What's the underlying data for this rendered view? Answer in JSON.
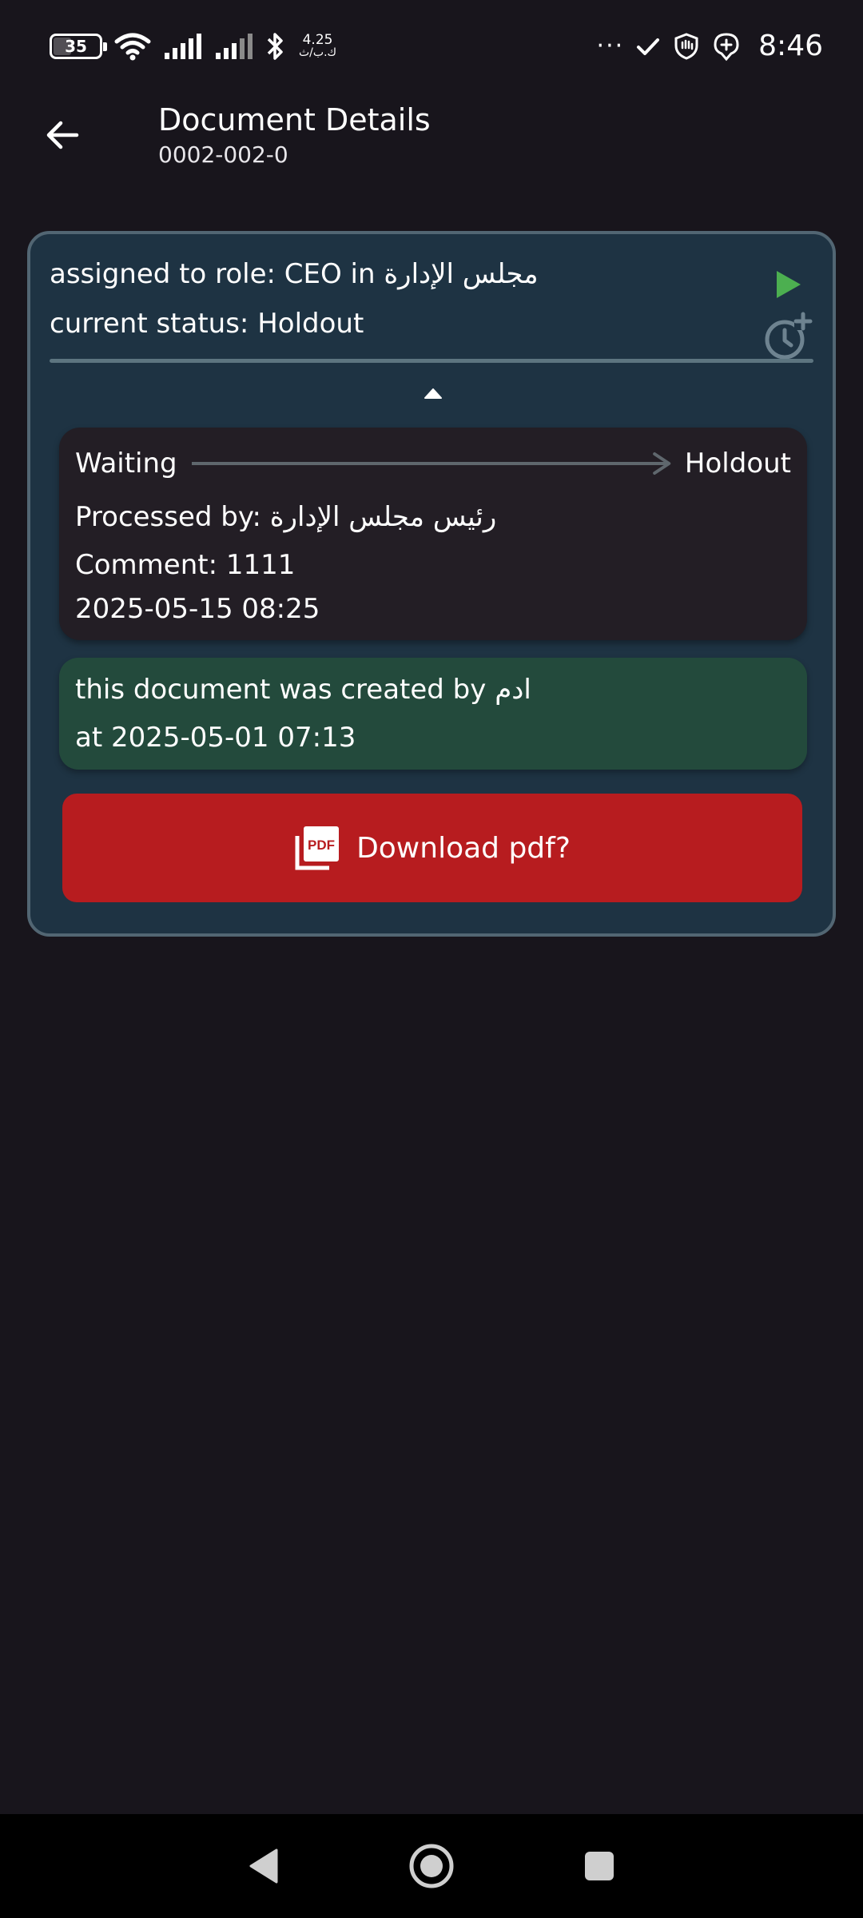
{
  "status_bar": {
    "battery_level": "35",
    "net_speed_value": "4.25",
    "net_speed_unit": "ك.ب/ث",
    "more_indicator": "···",
    "time": "8:46"
  },
  "app_bar": {
    "title": "Document Details",
    "subtitle": "0002-002-0"
  },
  "card": {
    "assigned_text": "assigned to role: CEO in مجلس الإدارة",
    "status_text": "current status: Holdout",
    "history_entry": {
      "from_state": "Waiting",
      "to_state": "Holdout",
      "processed_by": "Processed by: رئيس مجلس الإدارة",
      "comment": "Comment: 1111",
      "date": "2025-05-15 08:25"
    },
    "created": {
      "line1": "this document was created by ادم",
      "line2": "at 2025-05-01 07:13"
    },
    "download_label": "Download pdf?",
    "pdf_icon_text": "PDF"
  },
  "colors": {
    "background": "#18151c",
    "card": "#1e3343",
    "card_border": "#526673",
    "history_entry": "#231e25",
    "created_box": "#234a3c",
    "download_button": "#b71c1f",
    "play_icon": "#4caf50"
  },
  "icons": {
    "back": "arrow-back-icon",
    "play": "play-icon",
    "history": "schedule-add-icon",
    "collapse": "caret-up-icon",
    "pdf": "pdf-icon"
  }
}
